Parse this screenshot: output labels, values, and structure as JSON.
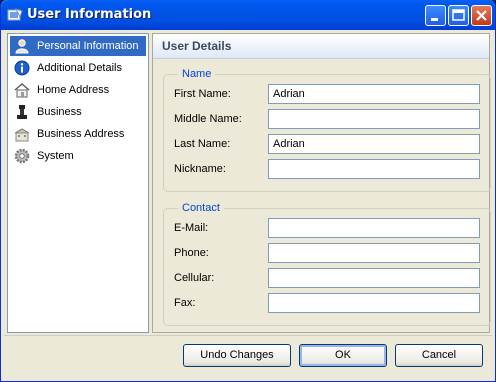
{
  "window": {
    "title": "User Information",
    "controls": [
      "minimize",
      "maximize",
      "close"
    ]
  },
  "sidebar": {
    "items": [
      {
        "label": "Personal Information",
        "icon": "person-icon",
        "selected": true
      },
      {
        "label": "Additional Details",
        "icon": "info-icon",
        "selected": false
      },
      {
        "label": "Home Address",
        "icon": "house-icon",
        "selected": false
      },
      {
        "label": "Business",
        "icon": "chess-piece-icon",
        "selected": false
      },
      {
        "label": "Business Address",
        "icon": "office-building-icon",
        "selected": false
      },
      {
        "label": "System",
        "icon": "gear-icon",
        "selected": false
      }
    ]
  },
  "panel": {
    "title": "User Details",
    "name_group": {
      "legend": "Name",
      "first_name": {
        "label": "First Name:",
        "value": "Adrian"
      },
      "middle_name": {
        "label": "Middle Name:",
        "value": ""
      },
      "last_name": {
        "label": "Last Name:",
        "value": "Adrian"
      },
      "nickname": {
        "label": "Nickname:",
        "value": ""
      }
    },
    "contact_group": {
      "legend": "Contact",
      "email": {
        "label": "E-Mail:",
        "value": ""
      },
      "phone": {
        "label": "Phone:",
        "value": ""
      },
      "cellular": {
        "label": "Cellular:",
        "value": ""
      },
      "fax": {
        "label": "Fax:",
        "value": ""
      }
    }
  },
  "buttons": {
    "undo": "Undo Changes",
    "ok": "OK",
    "cancel": "Cancel"
  },
  "colors": {
    "titlebar": "#0058ee",
    "selection": "#316ac5",
    "legend": "#0046d5"
  }
}
